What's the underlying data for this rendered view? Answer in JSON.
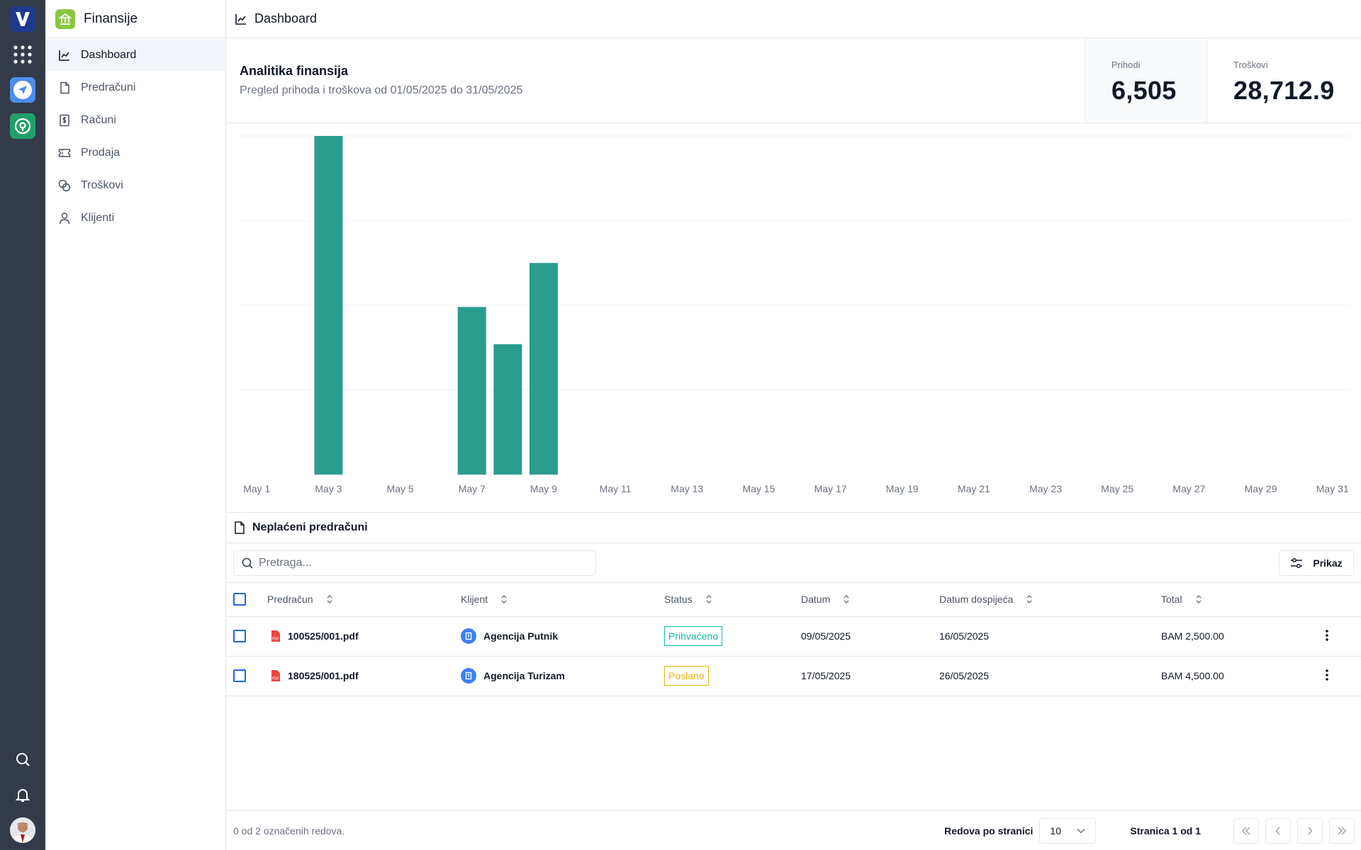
{
  "sidebar": {
    "app_title": "Finansije",
    "items": [
      {
        "label": "Dashboard",
        "icon": "chart-line-icon",
        "active": true
      },
      {
        "label": "Predračuni",
        "icon": "file-icon"
      },
      {
        "label": "Računi",
        "icon": "receipt-icon"
      },
      {
        "label": "Prodaja",
        "icon": "ticket-icon"
      },
      {
        "label": "Troškovi",
        "icon": "coins-icon"
      },
      {
        "label": "Klijenti",
        "icon": "user-icon"
      }
    ]
  },
  "header": {
    "title": "Dashboard"
  },
  "summary": {
    "title": "Analitika finansija",
    "subtitle": "Pregled prihoda i troškova od 01/05/2025 do 31/05/2025",
    "stats": [
      {
        "label": "Prihodi",
        "value": "6,505"
      },
      {
        "label": "Troškovi",
        "value": "28,712.9"
      }
    ]
  },
  "chart_data": {
    "type": "bar",
    "color": "#2a9d8f",
    "categories": [
      "May 1",
      "May 2",
      "May 3",
      "May 4",
      "May 5",
      "May 6",
      "May 7",
      "May 8",
      "May 9",
      "May 10",
      "May 11",
      "May 12",
      "May 13",
      "May 14",
      "May 15",
      "May 16",
      "May 17",
      "May 18",
      "May 19",
      "May 20",
      "May 21",
      "May 22",
      "May 23",
      "May 24",
      "May 25",
      "May 26",
      "May 27",
      "May 28",
      "May 29",
      "May 30",
      "May 31"
    ],
    "tick_labels": [
      "May 1",
      "May 3",
      "May 5",
      "May 7",
      "May 9",
      "May 11",
      "May 13",
      "May 15",
      "May 17",
      "May 19",
      "May 21",
      "May 23",
      "May 25",
      "May 27",
      "May 29",
      "May 31"
    ],
    "values": [
      0,
      0,
      1.0,
      0,
      0,
      0,
      0.495,
      0.385,
      0.625,
      0,
      0,
      0,
      0,
      0,
      0,
      0,
      0,
      0,
      0,
      0,
      0,
      0,
      0,
      0,
      0,
      0,
      0,
      0,
      0,
      0,
      0
    ],
    "ylim": [
      0,
      1
    ],
    "grid": true
  },
  "unpaid": {
    "title": "Neplaćeni predračuni",
    "search_placeholder": "Pretraga...",
    "view_label": "Prikaz",
    "columns": [
      "Predračun",
      "Klijent",
      "Status",
      "Datum",
      "Datum dospijeća",
      "Total"
    ],
    "rows": [
      {
        "invoice": "100525/001.pdf",
        "client": "Agencija Putnik",
        "status": "Prihvaćeno",
        "status_color": "#14b8a6",
        "date": "09/05/2025",
        "due": "16/05/2025",
        "total": "BAM 2,500.00"
      },
      {
        "invoice": "180525/001.pdf",
        "client": "Agencija Turizam",
        "status": "Poslano",
        "status_color": "#eab308",
        "date": "17/05/2025",
        "due": "26/05/2025",
        "total": "BAM 4,500.00"
      }
    ]
  },
  "footer": {
    "selection": "0 od 2 označenih redova.",
    "rows_label": "Redova po stranici",
    "rows_value": "10",
    "page_info": "Stranica 1 od 1"
  }
}
